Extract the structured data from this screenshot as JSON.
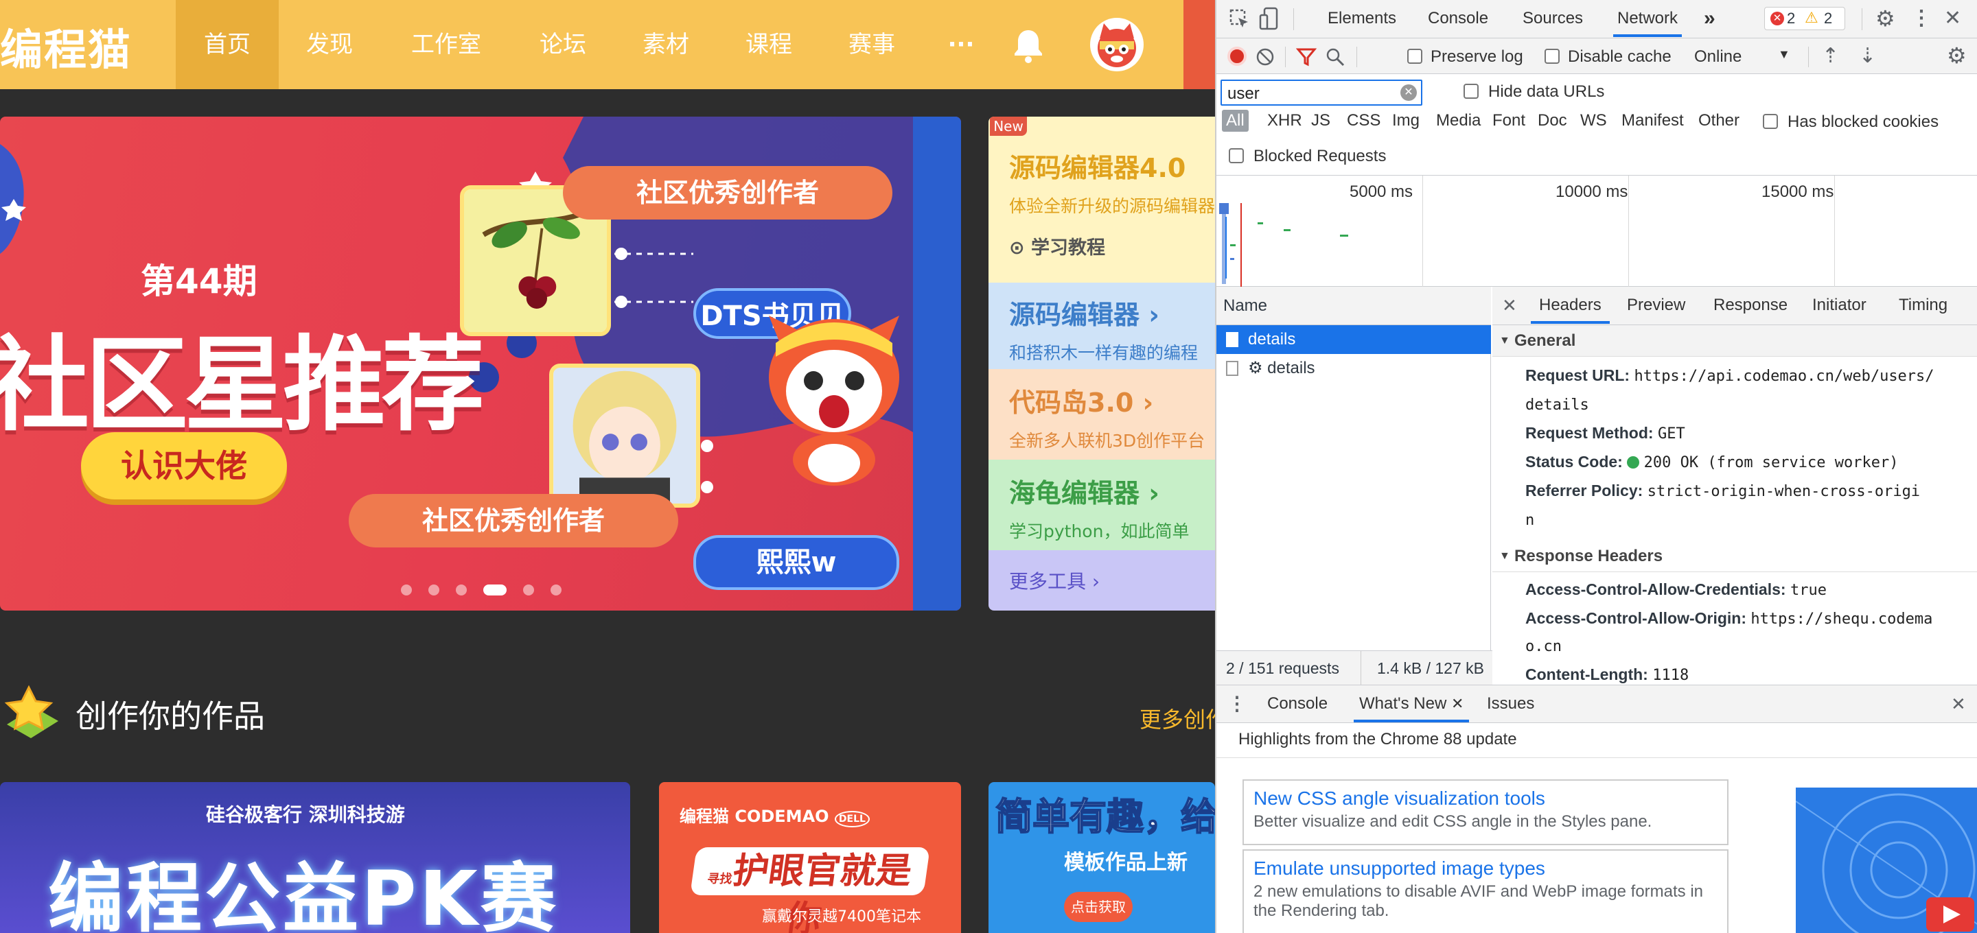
{
  "site": {
    "logo": "编程猫",
    "nav": [
      "首页",
      "发现",
      "工作室",
      "论坛",
      "素材",
      "课程",
      "赛事"
    ],
    "more": "···",
    "banner": {
      "issue": "第44期",
      "title": "社区星推荐",
      "button": "认识大佬",
      "tag_top": "社区优秀创作者",
      "tag_bottom": "社区优秀创作者",
      "name_top": "DTS书贝贝",
      "name_bottom": "熙熙w"
    },
    "side_menu": {
      "badge": "New",
      "items": [
        {
          "title": "源码编辑器4.0",
          "sub": "体验全新升级的源码编辑器",
          "extra": "学习教程",
          "bg": "#fff4c2",
          "color": "#e0a21d"
        },
        {
          "title": "源码编辑器 ›",
          "sub": "和搭积木一样有趣的编程",
          "bg": "#cfe3f8",
          "color": "#3d7ec9"
        },
        {
          "title": "代码岛3.0 ›",
          "sub": "全新多人联机3D创作平台",
          "bg": "#fde0c6",
          "color": "#e0893c"
        },
        {
          "title": "海龟编辑器 ›",
          "sub": "学习python，如此简单",
          "bg": "#c7efc8",
          "color": "#3c9e47"
        },
        {
          "title": "更多工具 ›",
          "bg": "#c9c6f6",
          "color": "#5a51c7"
        }
      ]
    },
    "create_title": "创作你的作品",
    "create_more": "更多创作",
    "cards": [
      {
        "top": "硅谷极客行  深圳科技游",
        "title": "编程公益PK赛"
      },
      {
        "logos": "编程猫 CODEMAO",
        "brand": "DELL",
        "title": "护眼官就是你",
        "prefix": "寻找",
        "sub": "赢戴尔灵越7400笔记本"
      },
      {
        "title": "简单有趣，给你",
        "sub": "模板作品上新",
        "button": "点击获取"
      }
    ]
  },
  "devtools": {
    "tabs": [
      "Elements",
      "Console",
      "Sources",
      "Network"
    ],
    "selected_tab": "Network",
    "errors": "2",
    "warnings": "2",
    "toolbar": {
      "preserve_log": "Preserve log",
      "disable_cache": "Disable cache",
      "throttle": "Online"
    },
    "filter": {
      "value": "user",
      "hide_data_urls": "Hide data URLs"
    },
    "types": [
      "All",
      "XHR",
      "JS",
      "CSS",
      "Img",
      "Media",
      "Font",
      "Doc",
      "WS",
      "Manifest",
      "Other"
    ],
    "has_blocked_cookies": "Has blocked cookies",
    "blocked_requests": "Blocked Requests",
    "timeline_labels": [
      "5000 ms",
      "10000 ms",
      "15000 ms"
    ],
    "name_header": "Name",
    "requests": [
      {
        "name": "details",
        "selected": true
      },
      {
        "name": "⚙ details",
        "selected": false
      }
    ],
    "status_bar": {
      "requests": "2 / 151 requests",
      "size": "1.4 kB / 127 kB"
    },
    "detail_tabs": [
      "Headers",
      "Preview",
      "Response",
      "Initiator",
      "Timing"
    ],
    "general_title": "General",
    "general": [
      {
        "k": "Request URL:",
        "v": "https://api.codemao.cn/web/users/",
        "v2": "details"
      },
      {
        "k": "Request Method:",
        "v": "GET"
      },
      {
        "k": "Status Code:",
        "v": "200 OK (from service worker)"
      },
      {
        "k": "Referrer Policy:",
        "v": "strict-origin-when-cross-origi",
        "v2": "n"
      }
    ],
    "response_title": "Response Headers",
    "response": [
      {
        "k": "Access-Control-Allow-Credentials:",
        "v": "true"
      },
      {
        "k": "Access-Control-Allow-Origin:",
        "v": "https://shequ.codema",
        "v2": "o.cn"
      },
      {
        "k": "Content-Length:",
        "v": "1118"
      }
    ],
    "drawer_tabs": [
      "Console",
      "What's New",
      "Issues"
    ],
    "whats_new_header": "Highlights from the Chrome 88 update",
    "news": [
      {
        "title": "New CSS angle visualization tools",
        "desc": "Better visualize and edit CSS angle in the Styles pane."
      },
      {
        "title": "Emulate unsupported image types",
        "desc": "2 new emulations to disable AVIF and WebP image formats in the Rendering tab."
      }
    ]
  },
  "colors": {
    "brand_yellow": "#f8c456",
    "devtools_blue": "#1a73e8",
    "banner_red": "#e8474f"
  }
}
